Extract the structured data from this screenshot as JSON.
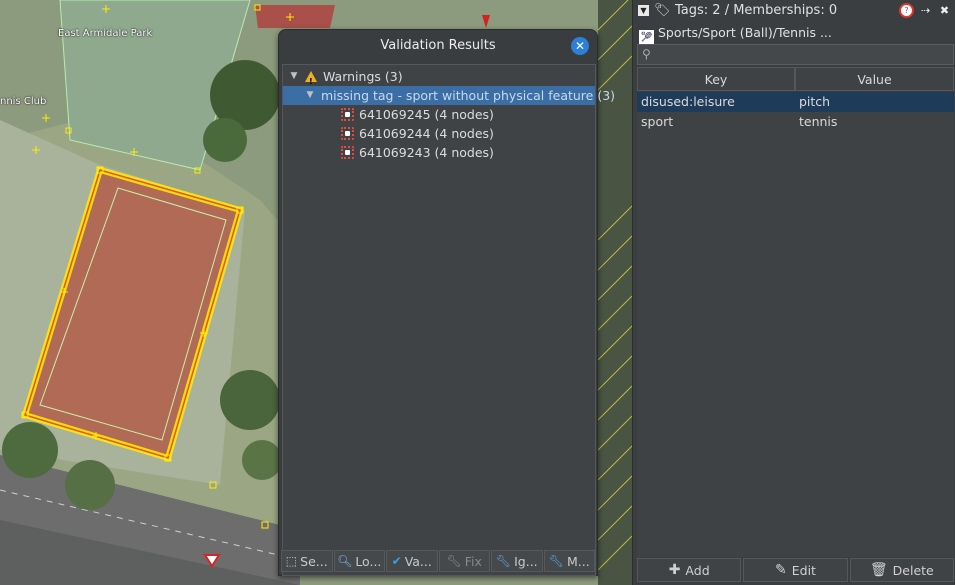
{
  "map": {
    "labels": [
      {
        "text": "East Armidale Park"
      },
      {
        "text": "nnis Club"
      }
    ]
  },
  "validation": {
    "title": "Validation Results",
    "tree": {
      "warnings_label": "Warnings (3)",
      "group_label": "missing tag - sport without physical feature (3)",
      "items": [
        {
          "label": "641069245 (4 nodes)"
        },
        {
          "label": "641069244 (4 nodes)"
        },
        {
          "label": "641069243 (4 nodes)"
        }
      ]
    },
    "toolbar": {
      "select": "Se...",
      "lookup": "Lo...",
      "validate": "Va...",
      "fix": "Fix",
      "ignore": "Ig...",
      "more": "M..."
    }
  },
  "tags": {
    "header_title": "Tags: 2 / Memberships: 0",
    "preset": "Sports/Sport (Ball)/Tennis ...",
    "search_placeholder": "",
    "columns": {
      "key": "Key",
      "value": "Value"
    },
    "rows": [
      {
        "key": "disused:leisure",
        "value": "pitch",
        "selected": true
      },
      {
        "key": "sport",
        "value": "tennis",
        "selected": false
      }
    ],
    "buttons": {
      "add": "Add",
      "edit": "Edit",
      "delete": "Delete"
    }
  },
  "colors": {
    "selection_blue": "#3b6ea5",
    "highlight_yellow": "#ffee00",
    "court_clay": "#b06a55",
    "warning_orange": "#f0b020",
    "close_blue": "#2e7fd6"
  }
}
